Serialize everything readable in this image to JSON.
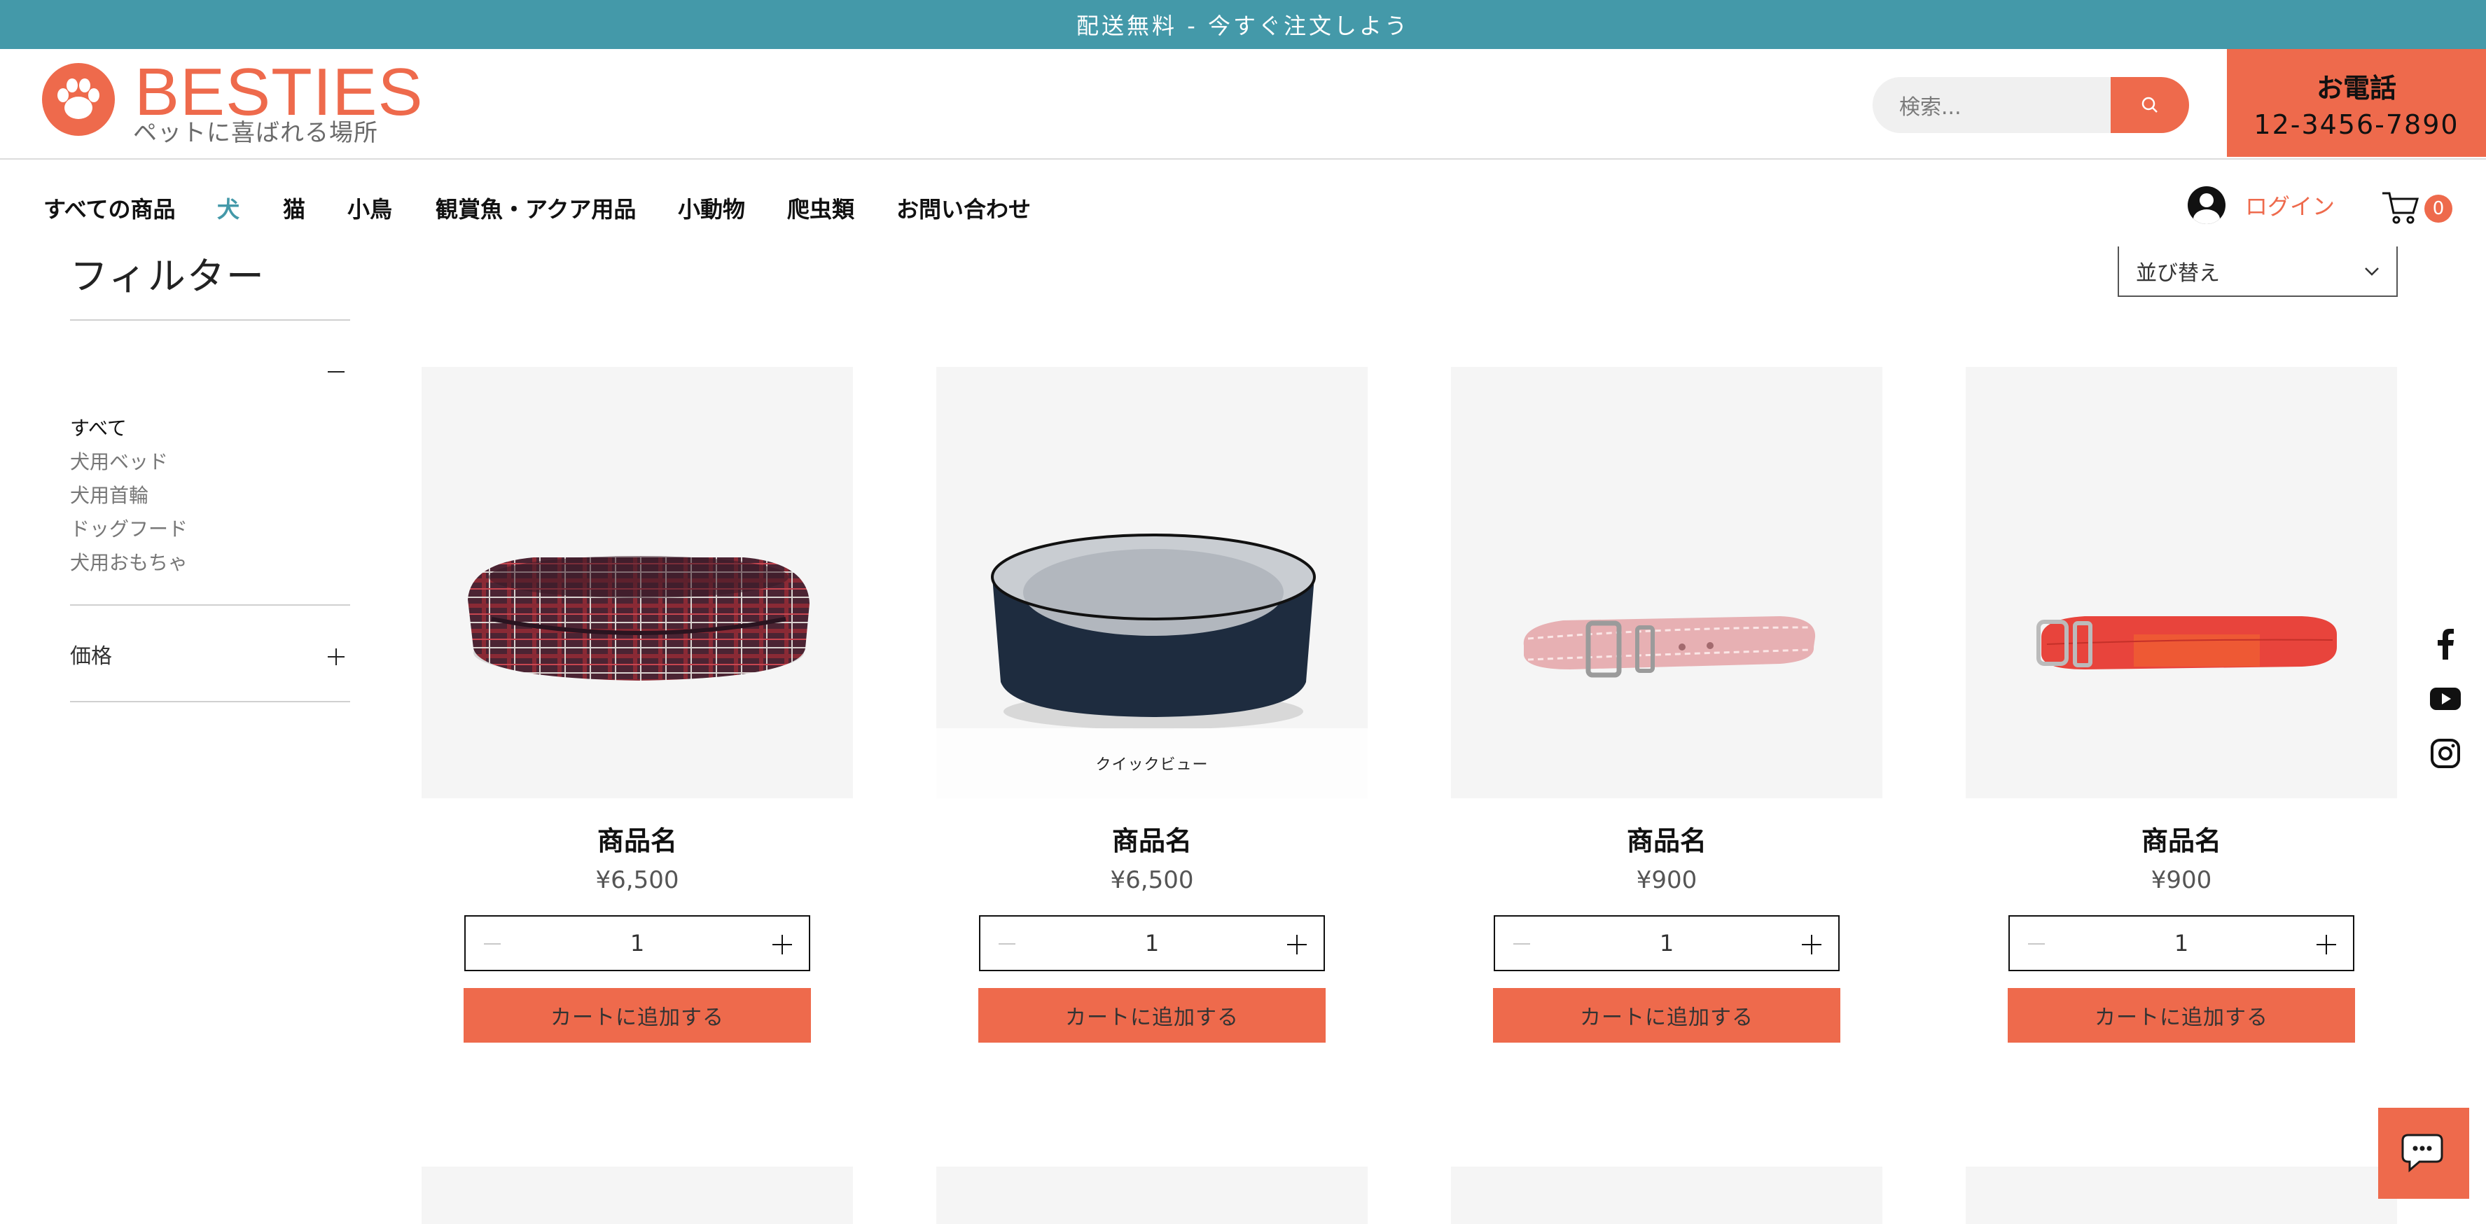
{
  "banner": {
    "text": "配送無料 - 今すぐ注文しよう"
  },
  "brand": {
    "name": "BESTIES",
    "tagline": "ペットに喜ばれる場所",
    "color": "#ee6a4c",
    "accent": "#4499a9"
  },
  "search": {
    "placeholder": "検索...",
    "icon": "search-icon"
  },
  "phone": {
    "label": "お電話",
    "number": "12-3456-7890"
  },
  "nav": {
    "items": [
      {
        "label": "すべての商品",
        "active": false
      },
      {
        "label": "犬",
        "active": true
      },
      {
        "label": "猫",
        "active": false
      },
      {
        "label": "小鳥",
        "active": false
      },
      {
        "label": "観賞魚・アクア用品",
        "active": false
      },
      {
        "label": "小動物",
        "active": false
      },
      {
        "label": "爬虫類",
        "active": false
      },
      {
        "label": "お問い合わせ",
        "active": false
      }
    ]
  },
  "account": {
    "login_label": "ログイン",
    "avatar_icon": "user-avatar-icon"
  },
  "cart": {
    "count": "0",
    "icon": "cart-icon"
  },
  "filter": {
    "title": "フィルター",
    "categories": [
      {
        "label": "すべて",
        "selected": true
      },
      {
        "label": "犬用ベッド",
        "selected": false
      },
      {
        "label": "犬用首輪",
        "selected": false
      },
      {
        "label": "ドッグフード",
        "selected": false
      },
      {
        "label": "犬用おもちゃ",
        "selected": false
      }
    ],
    "price_label": "価格"
  },
  "sort": {
    "label": "並び替え"
  },
  "products": [
    {
      "name": "商品名",
      "price": "¥6,500",
      "quantity": "1",
      "add_label": "カートに追加する",
      "image": "plaid-dog-bed"
    },
    {
      "name": "商品名",
      "price": "¥6,500",
      "quantity": "1",
      "add_label": "カートに追加する",
      "image": "navy-fleece-dog-bed",
      "quick_view": "クイックビュー"
    },
    {
      "name": "商品名",
      "price": "¥900",
      "quantity": "1",
      "add_label": "カートに追加する",
      "image": "pink-leather-collar"
    },
    {
      "name": "商品名",
      "price": "¥900",
      "quantity": "1",
      "add_label": "カートに追加する",
      "image": "red-collar"
    }
  ],
  "social": [
    "facebook-icon",
    "youtube-icon",
    "instagram-icon"
  ],
  "chat": {
    "icon": "chat-icon"
  }
}
